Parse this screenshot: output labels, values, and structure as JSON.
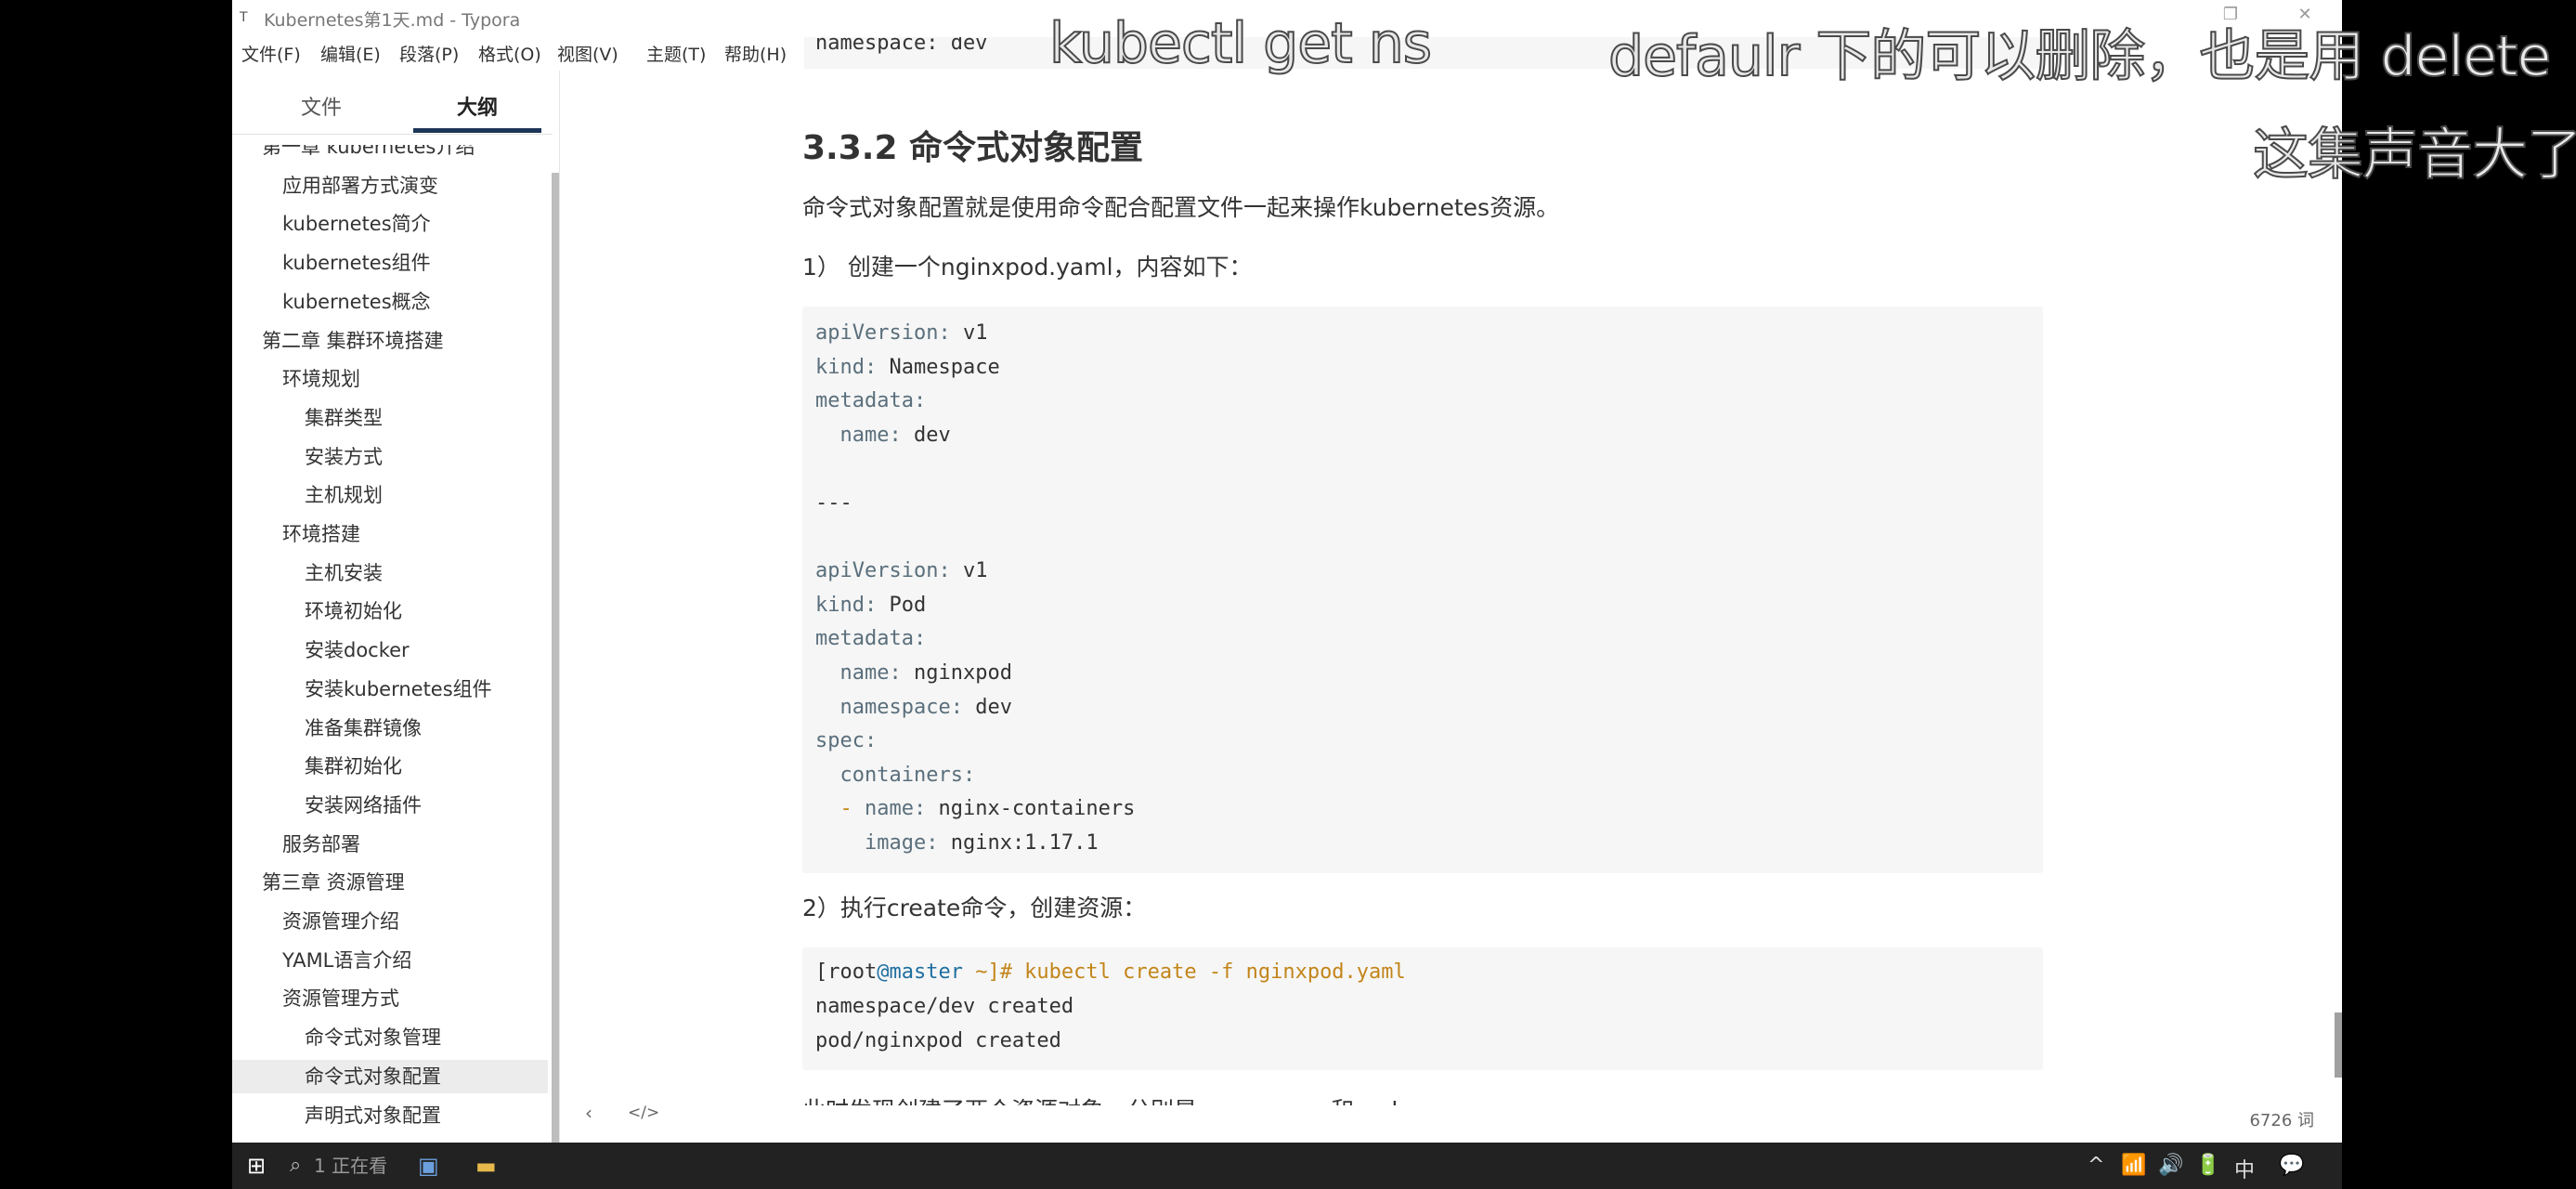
{
  "window": {
    "title": "Kubernetes第1天.md - Typora",
    "app_icon": "T"
  },
  "menu": [
    "文件(F)",
    "编辑(E)",
    "段落(P)",
    "格式(O)",
    "视图(V)",
    "主题(T)",
    "帮助(H)"
  ],
  "sidebar": {
    "tabs": [
      "文件",
      "大纲"
    ],
    "active_tab": "大纲",
    "outline": [
      {
        "label": "第一章 kubernetes介绍",
        "level": 0,
        "highlight": false
      },
      {
        "label": "应用部署方式演变",
        "level": 1,
        "highlight": false
      },
      {
        "label": "kubernetes简介",
        "level": 1,
        "highlight": false
      },
      {
        "label": "kubernetes组件",
        "level": 1,
        "highlight": false
      },
      {
        "label": "kubernetes概念",
        "level": 1,
        "highlight": false
      },
      {
        "label": "第二章 集群环境搭建",
        "level": 0,
        "highlight": false
      },
      {
        "label": "环境规划",
        "level": 1,
        "highlight": false
      },
      {
        "label": "集群类型",
        "level": 2,
        "highlight": false
      },
      {
        "label": "安装方式",
        "level": 2,
        "highlight": false
      },
      {
        "label": "主机规划",
        "level": 2,
        "highlight": false
      },
      {
        "label": "环境搭建",
        "level": 1,
        "highlight": false
      },
      {
        "label": "主机安装",
        "level": 2,
        "highlight": false
      },
      {
        "label": "环境初始化",
        "level": 2,
        "highlight": false
      },
      {
        "label": "安装docker",
        "level": 2,
        "highlight": false
      },
      {
        "label": "安装kubernetes组件",
        "level": 2,
        "highlight": false
      },
      {
        "label": "准备集群镜像",
        "level": 2,
        "highlight": false
      },
      {
        "label": "集群初始化",
        "level": 2,
        "highlight": false
      },
      {
        "label": "安装网络插件",
        "level": 2,
        "highlight": false
      },
      {
        "label": "服务部署",
        "level": 1,
        "highlight": false
      },
      {
        "label": "第三章 资源管理",
        "level": 0,
        "highlight": false
      },
      {
        "label": "资源管理介绍",
        "level": 1,
        "highlight": false
      },
      {
        "label": "YAML语言介绍",
        "level": 1,
        "highlight": false
      },
      {
        "label": "资源管理方式",
        "level": 1,
        "highlight": false
      },
      {
        "label": "命令式对象管理",
        "level": 2,
        "highlight": false
      },
      {
        "label": "命令式对象配置",
        "level": 2,
        "highlight": true
      },
      {
        "label": "声明式对象配置",
        "level": 2,
        "highlight": false
      }
    ],
    "footer": {
      "back_icon": "‹",
      "source_icon": "</>"
    }
  },
  "editor": {
    "prev_code_text": "namespace: dev",
    "heading": "3.3.2 命令式对象配置",
    "intro": "命令式对象配置就是使用命令配合配置文件一起来操作kubernetes资源。",
    "step1": "1） 创建一个nginxpod.yaml，内容如下：",
    "yaml_lines": [
      {
        "key": "apiVersion",
        "val": " v1",
        "indent": ""
      },
      {
        "key": "kind",
        "val": " Namespace",
        "indent": ""
      },
      {
        "key": "metadata",
        "val": "",
        "indent": ""
      },
      {
        "key": "name",
        "val": " dev",
        "indent": "  "
      },
      {
        "key": "",
        "val": "",
        "indent": ""
      },
      {
        "key": "",
        "val": "---",
        "indent": ""
      },
      {
        "key": "",
        "val": "",
        "indent": ""
      },
      {
        "key": "apiVersion",
        "val": " v1",
        "indent": ""
      },
      {
        "key": "kind",
        "val": " Pod",
        "indent": ""
      },
      {
        "key": "metadata",
        "val": "",
        "indent": ""
      },
      {
        "key": "name",
        "val": " nginxpod",
        "indent": "  "
      },
      {
        "key": "namespace",
        "val": " dev",
        "indent": "  "
      },
      {
        "key": "spec",
        "val": "",
        "indent": ""
      },
      {
        "key": "containers",
        "val": "",
        "indent": "  "
      },
      {
        "key": "name",
        "val": " nginx-containers",
        "indent": "  - "
      },
      {
        "key": "image",
        "val": " nginx:1.17.1",
        "indent": "    "
      }
    ],
    "step2": "2）执行create命令，创建资源：",
    "shell": {
      "prompt_user": "[root",
      "prompt_host": "@master",
      "prompt_end": " ~]#",
      "command": " kubectl create -f nginxpod.yaml",
      "outputs": [
        "namespace/dev created",
        "pod/nginxpod created"
      ]
    },
    "after": "此时发现创建了两个资源对象，分别是namespace和pod",
    "word_count": "6726 词"
  },
  "subtitles": {
    "line1_left": "kubectl get ns",
    "line1_right": "defaulr 下的可以删除，也是用 delete",
    "line2": "这集声音大了"
  },
  "taskbar": {
    "search_hint": "1 正在看",
    "tray": [
      "^",
      "📶",
      "🔊",
      "🔋",
      "中",
      "💬"
    ]
  }
}
